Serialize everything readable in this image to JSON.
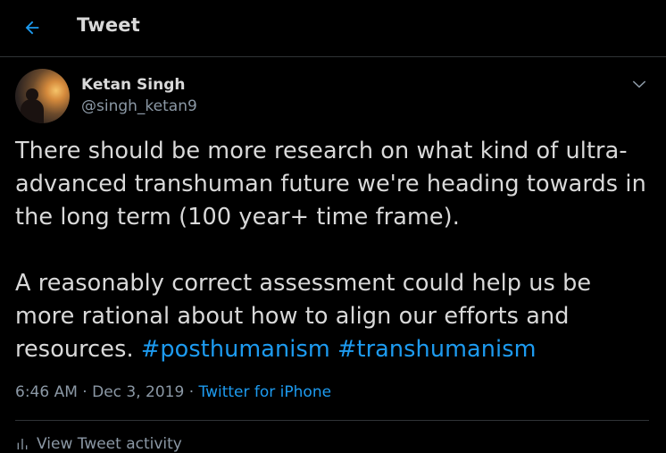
{
  "header": {
    "title": "Tweet",
    "back_icon": "arrow-left-icon"
  },
  "colors": {
    "accent": "#1d9bf0",
    "background": "#000000",
    "text": "#d9d9d9",
    "muted": "#8b98a5"
  },
  "tweet": {
    "author_name": "Ketan Singh",
    "author_handle": "@singh_ketan9",
    "paragraph_1": "There should be more research on what kind of ultra-advanced transhuman future we're heading towards in the long term (100 year+ time frame).",
    "paragraph_2_text": "A reasonably correct assessment could help us be more rational about how to align our efforts and resources.",
    "hashtags": [
      "#posthumanism",
      "#transhumanism"
    ],
    "time": "6:46 AM",
    "date": "Dec 3, 2019",
    "source": "Twitter for iPhone",
    "activity_label": "View Tweet activity"
  }
}
